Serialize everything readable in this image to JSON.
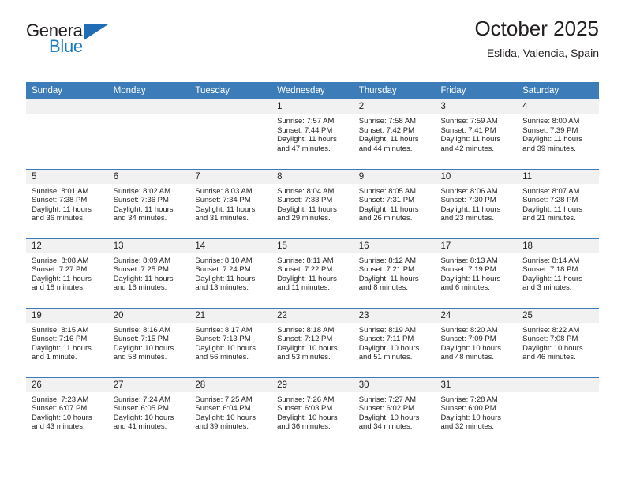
{
  "brand": {
    "name_top": "General",
    "name_bottom": "Blue",
    "color_primary": "#1f7cc1",
    "color_dark": "#231f20"
  },
  "header": {
    "title": "October 2025",
    "subtitle": "Eslida, Valencia, Spain"
  },
  "theme": {
    "header_row_bg": "#3c7cb8",
    "daynum_band_bg": "#f1f1f1",
    "cell_bg": "#ffffff",
    "grid_line": "#3c7cb8",
    "text": "#231f20"
  },
  "weekday_headers": [
    "Sunday",
    "Monday",
    "Tuesday",
    "Wednesday",
    "Thursday",
    "Friday",
    "Saturday"
  ],
  "weeks": [
    [
      {
        "day": "",
        "sunrise": "",
        "sunset": "",
        "daylight_1": "",
        "daylight_2": ""
      },
      {
        "day": "",
        "sunrise": "",
        "sunset": "",
        "daylight_1": "",
        "daylight_2": ""
      },
      {
        "day": "",
        "sunrise": "",
        "sunset": "",
        "daylight_1": "",
        "daylight_2": ""
      },
      {
        "day": "1",
        "sunrise": "Sunrise: 7:57 AM",
        "sunset": "Sunset: 7:44 PM",
        "daylight_1": "Daylight: 11 hours",
        "daylight_2": "and 47 minutes."
      },
      {
        "day": "2",
        "sunrise": "Sunrise: 7:58 AM",
        "sunset": "Sunset: 7:42 PM",
        "daylight_1": "Daylight: 11 hours",
        "daylight_2": "and 44 minutes."
      },
      {
        "day": "3",
        "sunrise": "Sunrise: 7:59 AM",
        "sunset": "Sunset: 7:41 PM",
        "daylight_1": "Daylight: 11 hours",
        "daylight_2": "and 42 minutes."
      },
      {
        "day": "4",
        "sunrise": "Sunrise: 8:00 AM",
        "sunset": "Sunset: 7:39 PM",
        "daylight_1": "Daylight: 11 hours",
        "daylight_2": "and 39 minutes."
      }
    ],
    [
      {
        "day": "5",
        "sunrise": "Sunrise: 8:01 AM",
        "sunset": "Sunset: 7:38 PM",
        "daylight_1": "Daylight: 11 hours",
        "daylight_2": "and 36 minutes."
      },
      {
        "day": "6",
        "sunrise": "Sunrise: 8:02 AM",
        "sunset": "Sunset: 7:36 PM",
        "daylight_1": "Daylight: 11 hours",
        "daylight_2": "and 34 minutes."
      },
      {
        "day": "7",
        "sunrise": "Sunrise: 8:03 AM",
        "sunset": "Sunset: 7:34 PM",
        "daylight_1": "Daylight: 11 hours",
        "daylight_2": "and 31 minutes."
      },
      {
        "day": "8",
        "sunrise": "Sunrise: 8:04 AM",
        "sunset": "Sunset: 7:33 PM",
        "daylight_1": "Daylight: 11 hours",
        "daylight_2": "and 29 minutes."
      },
      {
        "day": "9",
        "sunrise": "Sunrise: 8:05 AM",
        "sunset": "Sunset: 7:31 PM",
        "daylight_1": "Daylight: 11 hours",
        "daylight_2": "and 26 minutes."
      },
      {
        "day": "10",
        "sunrise": "Sunrise: 8:06 AM",
        "sunset": "Sunset: 7:30 PM",
        "daylight_1": "Daylight: 11 hours",
        "daylight_2": "and 23 minutes."
      },
      {
        "day": "11",
        "sunrise": "Sunrise: 8:07 AM",
        "sunset": "Sunset: 7:28 PM",
        "daylight_1": "Daylight: 11 hours",
        "daylight_2": "and 21 minutes."
      }
    ],
    [
      {
        "day": "12",
        "sunrise": "Sunrise: 8:08 AM",
        "sunset": "Sunset: 7:27 PM",
        "daylight_1": "Daylight: 11 hours",
        "daylight_2": "and 18 minutes."
      },
      {
        "day": "13",
        "sunrise": "Sunrise: 8:09 AM",
        "sunset": "Sunset: 7:25 PM",
        "daylight_1": "Daylight: 11 hours",
        "daylight_2": "and 16 minutes."
      },
      {
        "day": "14",
        "sunrise": "Sunrise: 8:10 AM",
        "sunset": "Sunset: 7:24 PM",
        "daylight_1": "Daylight: 11 hours",
        "daylight_2": "and 13 minutes."
      },
      {
        "day": "15",
        "sunrise": "Sunrise: 8:11 AM",
        "sunset": "Sunset: 7:22 PM",
        "daylight_1": "Daylight: 11 hours",
        "daylight_2": "and 11 minutes."
      },
      {
        "day": "16",
        "sunrise": "Sunrise: 8:12 AM",
        "sunset": "Sunset: 7:21 PM",
        "daylight_1": "Daylight: 11 hours",
        "daylight_2": "and 8 minutes."
      },
      {
        "day": "17",
        "sunrise": "Sunrise: 8:13 AM",
        "sunset": "Sunset: 7:19 PM",
        "daylight_1": "Daylight: 11 hours",
        "daylight_2": "and 6 minutes."
      },
      {
        "day": "18",
        "sunrise": "Sunrise: 8:14 AM",
        "sunset": "Sunset: 7:18 PM",
        "daylight_1": "Daylight: 11 hours",
        "daylight_2": "and 3 minutes."
      }
    ],
    [
      {
        "day": "19",
        "sunrise": "Sunrise: 8:15 AM",
        "sunset": "Sunset: 7:16 PM",
        "daylight_1": "Daylight: 11 hours",
        "daylight_2": "and 1 minute."
      },
      {
        "day": "20",
        "sunrise": "Sunrise: 8:16 AM",
        "sunset": "Sunset: 7:15 PM",
        "daylight_1": "Daylight: 10 hours",
        "daylight_2": "and 58 minutes."
      },
      {
        "day": "21",
        "sunrise": "Sunrise: 8:17 AM",
        "sunset": "Sunset: 7:13 PM",
        "daylight_1": "Daylight: 10 hours",
        "daylight_2": "and 56 minutes."
      },
      {
        "day": "22",
        "sunrise": "Sunrise: 8:18 AM",
        "sunset": "Sunset: 7:12 PM",
        "daylight_1": "Daylight: 10 hours",
        "daylight_2": "and 53 minutes."
      },
      {
        "day": "23",
        "sunrise": "Sunrise: 8:19 AM",
        "sunset": "Sunset: 7:11 PM",
        "daylight_1": "Daylight: 10 hours",
        "daylight_2": "and 51 minutes."
      },
      {
        "day": "24",
        "sunrise": "Sunrise: 8:20 AM",
        "sunset": "Sunset: 7:09 PM",
        "daylight_1": "Daylight: 10 hours",
        "daylight_2": "and 48 minutes."
      },
      {
        "day": "25",
        "sunrise": "Sunrise: 8:22 AM",
        "sunset": "Sunset: 7:08 PM",
        "daylight_1": "Daylight: 10 hours",
        "daylight_2": "and 46 minutes."
      }
    ],
    [
      {
        "day": "26",
        "sunrise": "Sunrise: 7:23 AM",
        "sunset": "Sunset: 6:07 PM",
        "daylight_1": "Daylight: 10 hours",
        "daylight_2": "and 43 minutes."
      },
      {
        "day": "27",
        "sunrise": "Sunrise: 7:24 AM",
        "sunset": "Sunset: 6:05 PM",
        "daylight_1": "Daylight: 10 hours",
        "daylight_2": "and 41 minutes."
      },
      {
        "day": "28",
        "sunrise": "Sunrise: 7:25 AM",
        "sunset": "Sunset: 6:04 PM",
        "daylight_1": "Daylight: 10 hours",
        "daylight_2": "and 39 minutes."
      },
      {
        "day": "29",
        "sunrise": "Sunrise: 7:26 AM",
        "sunset": "Sunset: 6:03 PM",
        "daylight_1": "Daylight: 10 hours",
        "daylight_2": "and 36 minutes."
      },
      {
        "day": "30",
        "sunrise": "Sunrise: 7:27 AM",
        "sunset": "Sunset: 6:02 PM",
        "daylight_1": "Daylight: 10 hours",
        "daylight_2": "and 34 minutes."
      },
      {
        "day": "31",
        "sunrise": "Sunrise: 7:28 AM",
        "sunset": "Sunset: 6:00 PM",
        "daylight_1": "Daylight: 10 hours",
        "daylight_2": "and 32 minutes."
      },
      {
        "day": "",
        "sunrise": "",
        "sunset": "",
        "daylight_1": "",
        "daylight_2": ""
      }
    ]
  ]
}
